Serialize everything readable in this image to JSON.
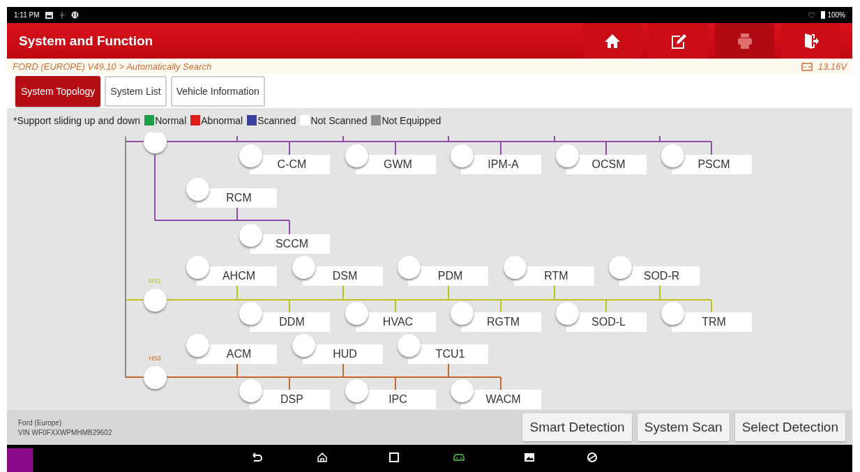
{
  "status_bar": {
    "time": "1:11 PM",
    "battery": "100%"
  },
  "header": {
    "title": "System and Function",
    "tools": [
      {
        "kind": "home",
        "disabled": false
      },
      {
        "kind": "edit",
        "disabled": false
      },
      {
        "kind": "print",
        "disabled": true
      },
      {
        "kind": "exit",
        "disabled": false
      }
    ]
  },
  "breadcrumb": "FORD (EUROPE) V49.10 > Automatically Search",
  "voltage": "13.16V",
  "tabs": [
    {
      "label": "System Topology",
      "selected": true
    },
    {
      "label": "System List",
      "selected": false
    },
    {
      "label": "Vehicle Information",
      "selected": false
    }
  ],
  "legend": {
    "note": "*Support sliding up and down",
    "items": [
      {
        "label": "Normal",
        "color": "#1f9e4a"
      },
      {
        "label": "Abnormal",
        "color": "#e01b1b"
      },
      {
        "label": "Scanned",
        "color": "#3b3f9e"
      },
      {
        "label": "Not Scanned",
        "color": "#ffffff"
      },
      {
        "label": "Not Equipped",
        "color": "#8f8f8f"
      }
    ]
  },
  "topology": {
    "buses": [
      {
        "color": "#8e4aa8",
        "lower": [
          {
            "name": "C-CM",
            "color": "#ffffff"
          },
          {
            "name": "GWM",
            "color": "#ffffff"
          },
          {
            "name": "IPM-A",
            "color": "#ffffff"
          },
          {
            "name": "OCSM",
            "color": "#ffffff"
          },
          {
            "name": "PSCM",
            "color": "#ffffff"
          }
        ],
        "branch": [
          {
            "name": "RCM",
            "color": "#ffffff"
          },
          {
            "name": "SCCM",
            "color": "#ffffff"
          }
        ]
      },
      {
        "label": "MS1",
        "color": "#b8c41c",
        "upper": [
          {
            "name": "AHCM",
            "color": "#ffffff"
          },
          {
            "name": "DSM",
            "color": "#ffffff"
          },
          {
            "name": "PDM",
            "color": "#ffffff"
          },
          {
            "name": "RTM",
            "color": "#ffffff"
          },
          {
            "name": "SOD-R",
            "color": "#ffffff"
          }
        ],
        "lower": [
          {
            "name": "DDM",
            "color": "#ffffff"
          },
          {
            "name": "HVAC",
            "color": "#ffffff"
          },
          {
            "name": "RGTM",
            "color": "#ffffff"
          },
          {
            "name": "SOD-L",
            "color": "#ffffff"
          },
          {
            "name": "TRM",
            "color": "#ffffff"
          }
        ]
      },
      {
        "label": "HS3",
        "color": "#c4692c",
        "upper": [
          {
            "name": "ACM",
            "color": "#ffffff"
          },
          {
            "name": "HUD",
            "color": "#ffffff"
          },
          {
            "name": "TCU1",
            "color": "#ffffff"
          }
        ],
        "lower": [
          {
            "name": "DSP",
            "color": "#ffffff"
          },
          {
            "name": "IPC",
            "color": "#ffffff"
          },
          {
            "name": "WACM",
            "color": "#ffffff"
          }
        ]
      }
    ]
  },
  "footer": {
    "make": "Ford (Europe)",
    "vin": "VIN WF0FXXWPMHMB29602",
    "buttons": [
      "Smart Detection",
      "System Scan",
      "Select Detection"
    ]
  }
}
